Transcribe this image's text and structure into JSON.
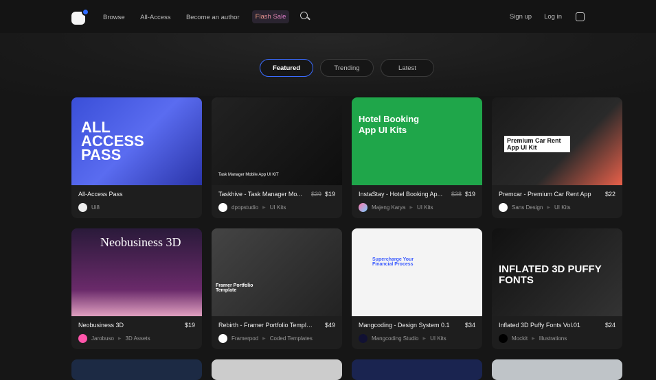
{
  "nav": {
    "browse": "Browse",
    "all_access": "All-Access",
    "become_author": "Become an author",
    "flash_sale": "Flash Sale",
    "sign_up": "Sign up",
    "log_in": "Log in"
  },
  "tabs": [
    "Featured",
    "Trending",
    "Latest"
  ],
  "cards": [
    {
      "title": "All-Access Pass",
      "old_price": "",
      "price": "",
      "author": "Ui8",
      "category": "",
      "thumb_text": "ALL ACCESS PASS",
      "bg": "linear-gradient(135deg,#3a4fd8,#5a6cf0 50%,#2a34a8)",
      "av": "#eee"
    },
    {
      "title": "Taskhive - Task Manager Mo...",
      "old_price": "$39",
      "price": "$19",
      "author": "dpopstudio",
      "category": "UI Kits",
      "thumb_text": "Task Manager Mobile App UI KIT",
      "bg": "linear-gradient(135deg,#222,#0e0e0e)",
      "av": "#fff"
    },
    {
      "title": "InstaStay - Hotel Booking Ap...",
      "old_price": "$38",
      "price": "$19",
      "author": "Majeng Karya",
      "category": "UI Kits",
      "thumb_text": "Hotel Booking App UI Kits",
      "bg": "#1fa64a",
      "av": "linear-gradient(135deg,#f7a,#7cf)"
    },
    {
      "title": "Premcar - Premium Car Rent App",
      "old_price": "",
      "price": "$22",
      "author": "Sans Design",
      "category": "UI Kits",
      "thumb_text": "Premium Car Rent App UI Kit",
      "bg": "linear-gradient(135deg,#1a1a1a,#2a2a2a 60%,#e8604a)",
      "av": "#fff"
    },
    {
      "title": "Neobusiness 3D",
      "old_price": "",
      "price": "$19",
      "author": "Jarobuso",
      "category": "3D Assets",
      "thumb_text": "Neobusiness 3D",
      "bg": "linear-gradient(180deg,#2a1a3a,#6a2a6a 70%,#e0a0c0)",
      "av": "#f5a"
    },
    {
      "title": "Rebirth - Framer Portfolio Template",
      "old_price": "",
      "price": "$49",
      "author": "Framerpod",
      "category": "Coded Templates",
      "thumb_text": "Framer Portfolio Template",
      "bg": "linear-gradient(135deg,#444,#222)",
      "av": "#fff"
    },
    {
      "title": "Mangcoding - Design System 0.1",
      "old_price": "",
      "price": "$34",
      "author": "Mangcoding Studio",
      "category": "UI Kits",
      "thumb_text": "Supercharge Your Financial Process",
      "bg": "#f4f4f4",
      "av": "#113"
    },
    {
      "title": "Inflated 3D Puffy Fonts Vol.01",
      "old_price": "",
      "price": "$24",
      "author": "Mockit",
      "category": "Illustrations",
      "thumb_text": "INFLATED 3D PUFFY FONTS",
      "bg": "linear-gradient(135deg,#111,#333)",
      "av": "#000"
    }
  ]
}
